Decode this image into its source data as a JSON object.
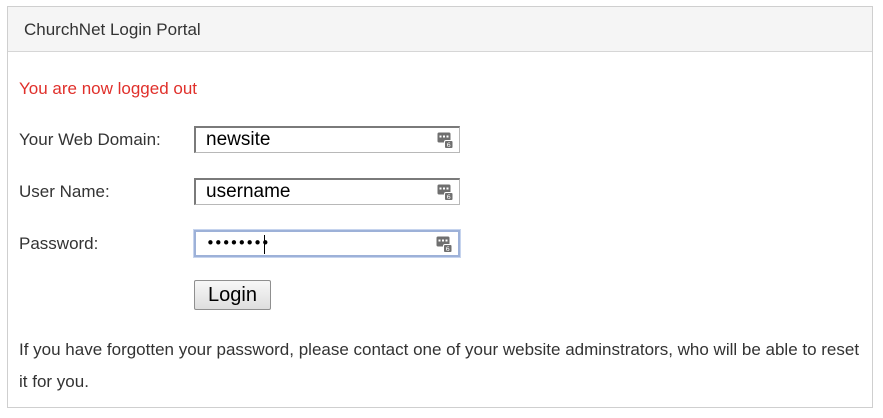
{
  "header": {
    "title": "ChurchNet Login Portal"
  },
  "status": {
    "message": "You are now logged out"
  },
  "form": {
    "domain": {
      "label": "Your Web Domain:",
      "value": "newsite"
    },
    "username": {
      "label": "User Name:",
      "value": "username"
    },
    "password": {
      "label": "Password:",
      "masked_value": "••••••••"
    },
    "login_label": "Login"
  },
  "help": {
    "text": "If you have forgotten your password, please contact one of your website adminstrators, who will be able to reset it for you."
  },
  "colors": {
    "error": "#e0302b",
    "focus_border": "#9db1d8"
  },
  "icons": {
    "field_icon": "password-manager-key-icon"
  }
}
